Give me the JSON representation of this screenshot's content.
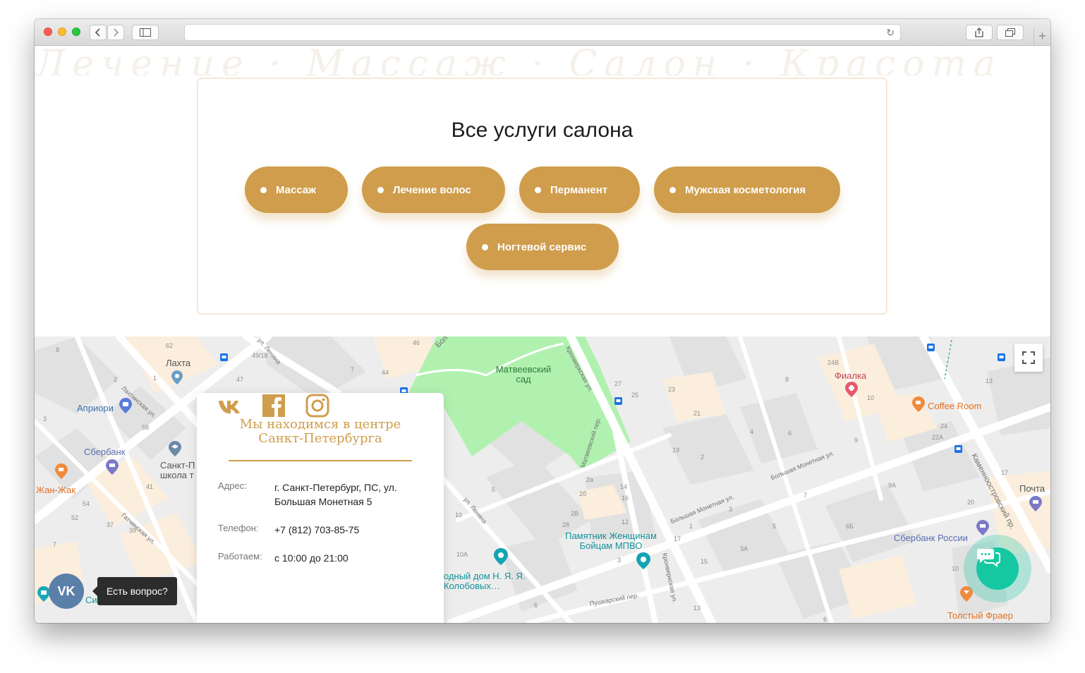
{
  "browser": {
    "address_text": ""
  },
  "background_script": "Лечение · Массаж · Салон · Красота",
  "services": {
    "title": "Все услуги салона",
    "items": [
      {
        "label": "Массаж"
      },
      {
        "label": "Лечение волос"
      },
      {
        "label": "Перманент"
      },
      {
        "label": "Мужская косметология"
      },
      {
        "label": "Ногтевой сервис"
      }
    ],
    "accent_color": "#cf9d4c"
  },
  "contacts": {
    "title": "Мы находимся в центре Санкт-Петербурга",
    "address_label": "Адрес:",
    "address_value": "г. Санкт-Петербург, ПС, ул. Большая Монетная 5",
    "phone_label": "Телефон:",
    "phone_value": "+7 (812) 703-85-75",
    "hours_label": "Работаем:",
    "hours_value": "с 10:00 до 21:00",
    "social_icons": [
      "vk-icon",
      "facebook-icon",
      "instagram-icon"
    ]
  },
  "map": {
    "places": {
      "lahta": "Лахта",
      "apriori": "Априори",
      "sberbank": "Сбербанк",
      "school": "Санкт-П школа т",
      "zhan_zhak": "Жан-Жак",
      "matveevsky": "Матвеевский сад",
      "fialka": "Фиалка",
      "coffee_room": "Coffee Room",
      "pochta": "Почта",
      "sberbank_russia": "Сбербанк России",
      "monument": "Памятник Женщинам Бойцам МПВО",
      "kolobov": "одный дом Н. Я. Я. Колобовых…",
      "tolsty_fraer": "Толстый Фраер",
      "sinema": "Синема"
    },
    "streets": {
      "lenina_top": "ул. Ленина",
      "lakhtinskaya": "Лахтинская ул.",
      "gatchinskaya": "Гатчинская ул.",
      "kronverkskaya": "Кронверкская ул.",
      "matveevsky_per": "Матвеевский пер.",
      "bolshaya_monetnaya_1": "Большая Монетная ул.",
      "bolshaya_monetnaya_2": "Большая Монетная ул.",
      "pushkarsky": "Пушкарский пер.",
      "kronverkskaya_2": "Кронверкская ул.",
      "kamennoostrovsky": "Каменноостровский пр.",
      "lenina_mid": "ул. Ленина",
      "bol_top": "Бол"
    },
    "numbers": [
      "62",
      "8",
      "2",
      "1",
      "3",
      "58",
      "41",
      "54",
      "52",
      "37",
      "39",
      "7",
      "49/18",
      "47",
      "7",
      "44",
      "46",
      "27",
      "25",
      "23",
      "21",
      "24В",
      "8",
      "10",
      "13",
      "4",
      "6",
      "19",
      "2",
      "9",
      "24",
      "22А",
      "2а",
      "2б",
      "2В",
      "28",
      "14",
      "16",
      "12",
      "5",
      "10",
      "10А",
      "17",
      "15",
      "3А",
      "5",
      "6Б",
      "7",
      "9А",
      "20",
      "17",
      "3",
      "13",
      "6",
      "10",
      "6",
      "3",
      "1"
    ]
  },
  "widgets": {
    "vk_button": "VK",
    "vk_tooltip": "Есть вопрос?"
  },
  "colors": {
    "accent": "#cf9d4c",
    "park": "#b1f1b0",
    "chat": "#16c8a2",
    "vk": "#5a7fa8"
  }
}
